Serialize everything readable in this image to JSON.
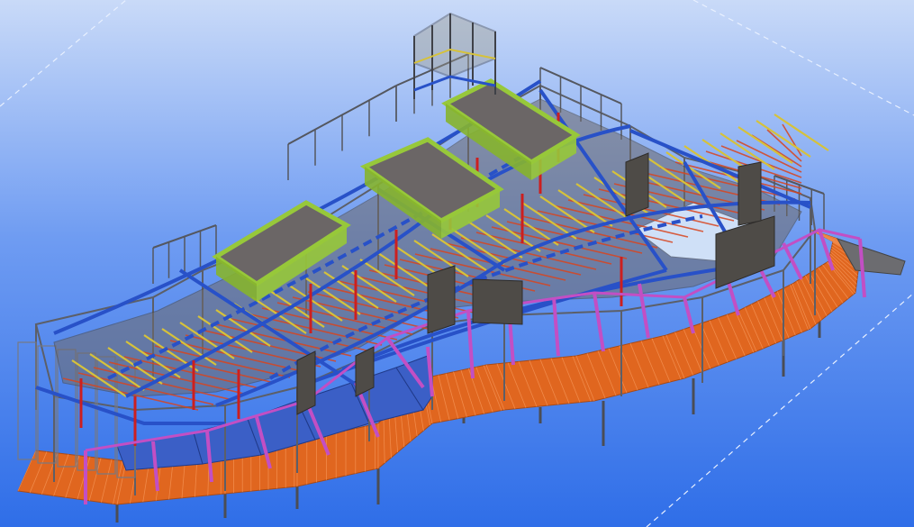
{
  "viewport": {
    "background_top": "#c9daf8",
    "background_mid": "#6f9cf2",
    "background_bottom": "#2f6ee8",
    "guide_line_color": "#e8f0ff"
  },
  "model": {
    "colors": {
      "steel_frame": "#5c5f68",
      "slab_top": "#6f6a6a",
      "slab_side": "#55524f",
      "main_beam": "#2851c8",
      "secondary_beam": "#d6c23a",
      "joist": "#d8451f",
      "column": "#cc1f1f",
      "curtain_wall": "#c24fc4",
      "parapet": "#97c83a",
      "walkway_deck": "#e0661f",
      "canopy_panel": "#3b5fc6",
      "shear_wall": "#4e4b47"
    }
  }
}
